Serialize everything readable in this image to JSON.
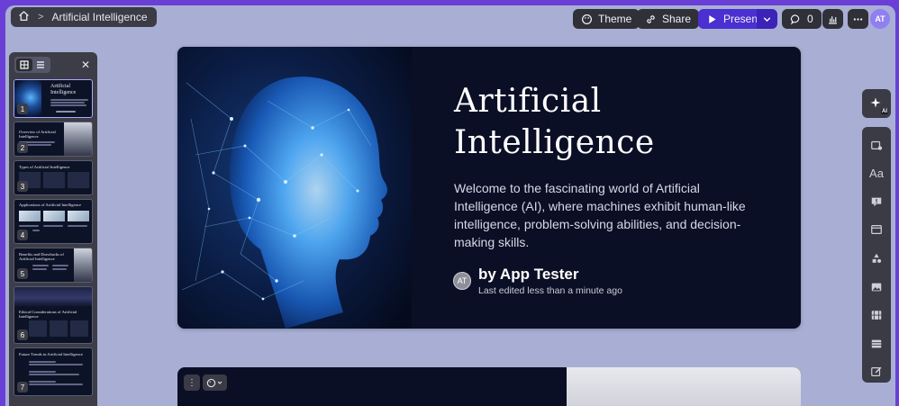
{
  "breadcrumb": {
    "title": "Artificial Intelligence"
  },
  "toolbar": {
    "theme_label": "Theme",
    "share_label": "Share",
    "present_label": "Present",
    "comment_count": "0",
    "user_initials": "AT"
  },
  "thumbnails": [
    {
      "num": "1",
      "title": "Artificial Intelligence"
    },
    {
      "num": "2",
      "title": "Overview of Artificial Intelligence"
    },
    {
      "num": "3",
      "title": "Types of Artificial Intelligence"
    },
    {
      "num": "4",
      "title": "Applications of Artificial Intelligence"
    },
    {
      "num": "5",
      "title": "Benefits and Drawbacks of Artificial Intelligence"
    },
    {
      "num": "6",
      "title": "Ethical Considerations of Artificial Intelligence"
    },
    {
      "num": "7",
      "title": "Future Trends in Artificial Intelligence"
    }
  ],
  "slide": {
    "title": "Artificial Intelligence",
    "description": "Welcome to the fascinating world of Artificial Intelligence (AI), where machines exhibit human-like intelligence, problem-solving abilities, and decision-making skills.",
    "author_initials": "AT",
    "author": "by App Tester",
    "edited": "Last edited less than a minute ago"
  },
  "right_toolbar": {
    "ai_badge": "AI",
    "tools": [
      "add-card-icon",
      "text-icon",
      "callout-icon",
      "layout-icon",
      "shapes-icon",
      "image-icon",
      "video-icon",
      "table-icon",
      "edit-icon"
    ]
  },
  "colors": {
    "accent": "#4b2fd0",
    "frame": "#6a3fd6",
    "canvas": "#a9aed4",
    "slide_bg": "#0b0f26"
  }
}
